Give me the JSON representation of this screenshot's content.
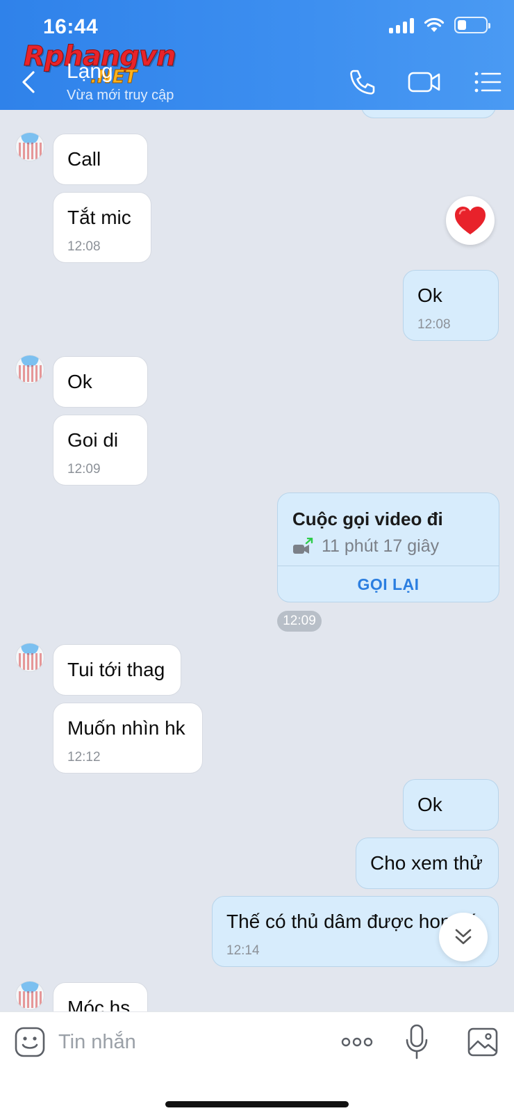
{
  "status_bar": {
    "time": "16:44"
  },
  "watermark": {
    "main": "Rphangvn",
    "sub": ".NET"
  },
  "header": {
    "contact_name": "Lạng",
    "contact_status": "Vừa mới truy cập"
  },
  "messages": [
    {
      "side": "in",
      "text": "Call"
    },
    {
      "side": "in",
      "text": "Tắt mic",
      "time": "12:08"
    },
    {
      "side": "out",
      "text": "Ok",
      "time": "12:08"
    },
    {
      "side": "in",
      "text": "Ok"
    },
    {
      "side": "in",
      "text": "Goi di",
      "time": "12:09"
    },
    {
      "side": "in",
      "text": "Tui tới thag"
    },
    {
      "side": "in",
      "text": "Muốn nhìn hk",
      "time": "12:12"
    },
    {
      "side": "out",
      "text": "Ok"
    },
    {
      "side": "out",
      "text": "Cho xem thử"
    },
    {
      "side": "out",
      "text": "Thế có thủ dâm được hong á",
      "time": "12:14"
    },
    {
      "side": "in",
      "text": "Móc hs"
    }
  ],
  "reaction": {
    "emoji": "heart"
  },
  "call_card": {
    "title": "Cuộc gọi video đi",
    "duration": "11 phút 17 giây",
    "action": "GỌI LẠI",
    "time": "12:09"
  },
  "input_bar": {
    "placeholder": "Tin nhắn"
  },
  "colors": {
    "header_blue": "#3d8ff0",
    "outgoing_bubble": "#d7ecfc",
    "incoming_bubble": "#ffffff",
    "chat_bg": "#e2e6ee",
    "link_blue": "#2b7ee0"
  },
  "icons": [
    "back-arrow-icon",
    "phone-icon",
    "video-camera-icon",
    "menu-list-icon",
    "heart-icon",
    "video-call-outgoing-icon",
    "double-chevron-down-icon",
    "sticker-icon",
    "more-dots-icon",
    "microphone-icon",
    "image-icon"
  ]
}
